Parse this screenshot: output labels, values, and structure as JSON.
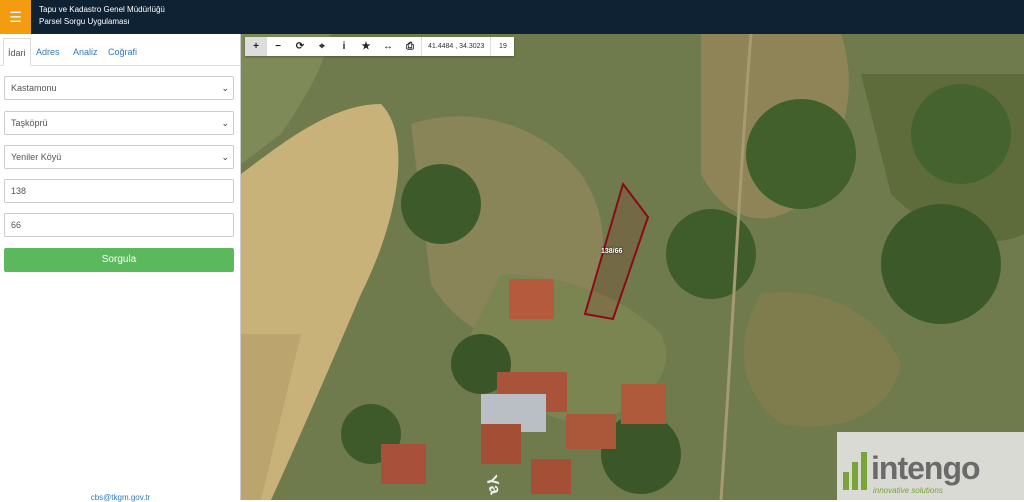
{
  "header": {
    "title_line1": "Tapu ve Kadastro Genel Müdürlüğü",
    "title_line2": "Parsel Sorgu Uygulaması",
    "menu_icon": "hamburger-icon"
  },
  "sidebar": {
    "tabs": [
      {
        "label": "İdari"
      },
      {
        "label": "Adres"
      },
      {
        "label": "Analiz"
      },
      {
        "label": "Coğrafi"
      }
    ],
    "province": "Kastamonu",
    "district": "Taşköprü",
    "village": "Yeniler Köyü",
    "block": "138",
    "parcel": "66",
    "submit_label": "Sorgula",
    "footer_link": "cbs@tkgm.gov.tr"
  },
  "map": {
    "toolbar_icons": [
      "zoom-in-icon",
      "zoom-out-icon",
      "refresh-icon",
      "locate-icon",
      "info-icon",
      "star-icon",
      "measure-icon",
      "print-icon"
    ],
    "coordinates": "41.4484 , 34.3023",
    "zoom_level": "19",
    "parcel_label": "138/66",
    "road_label": "Ya",
    "watermark_text": "intengo",
    "watermark_sub": "innovative solutions"
  },
  "colors": {
    "topbar": "#0e2233",
    "menu_btn": "#f39c12",
    "submit": "#5cb85c",
    "parcel_outline": "#8b0a1a",
    "link": "#337ab7"
  }
}
